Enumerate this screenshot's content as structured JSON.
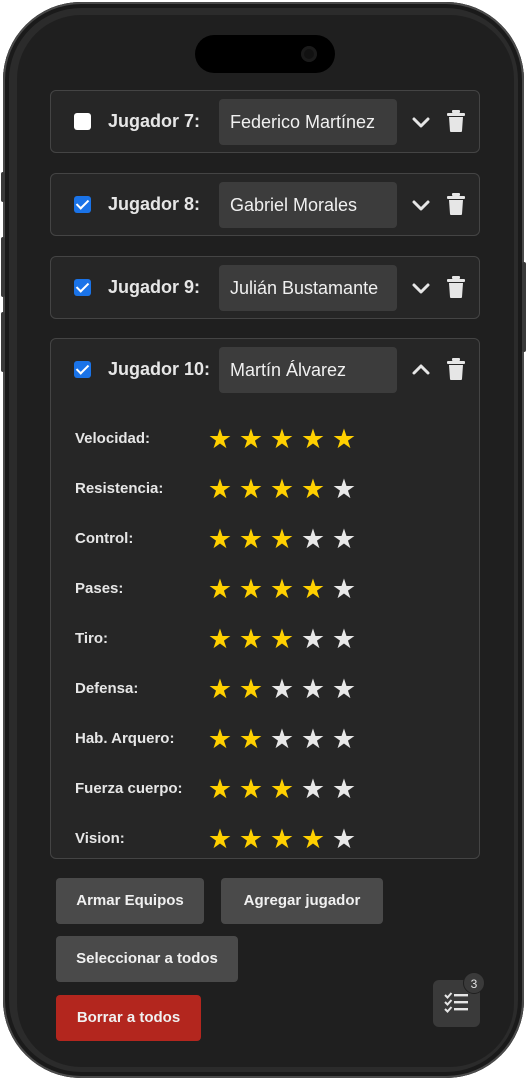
{
  "players": [
    {
      "label": "Jugador 7:",
      "name": "Federico Martínez",
      "checked": false,
      "expanded": false
    },
    {
      "label": "Jugador 8:",
      "name": "Gabriel Morales",
      "checked": true,
      "expanded": false
    },
    {
      "label": "Jugador 9:",
      "name": "Julián Bustamante",
      "checked": true,
      "expanded": false
    },
    {
      "label": "Jugador 10:",
      "name": "Martín Álvarez",
      "checked": true,
      "expanded": true
    }
  ],
  "attributes": [
    {
      "label": "Velocidad:",
      "rating": 5
    },
    {
      "label": "Resistencia:",
      "rating": 4
    },
    {
      "label": "Control:",
      "rating": 3
    },
    {
      "label": "Pases:",
      "rating": 4
    },
    {
      "label": "Tiro:",
      "rating": 3
    },
    {
      "label": "Defensa:",
      "rating": 2
    },
    {
      "label": "Hab. Arquero:",
      "rating": 2
    },
    {
      "label": "Fuerza cuerpo:",
      "rating": 3
    },
    {
      "label": "Vision:",
      "rating": 4
    }
  ],
  "max_rating": 5,
  "actions": {
    "armar": "Armar Equipos",
    "agregar": "Agregar jugador",
    "seleccionar": "Seleccionar a todos",
    "borrar": "Borrar a todos"
  },
  "fab": {
    "badge_count": "3",
    "icon": "checklist-icon"
  },
  "colors": {
    "background": "#1f1f1f",
    "card": "#262626",
    "checkbox_checked": "#1a73e8",
    "star_on": "#ffd000",
    "star_off": "#e8e8e8",
    "danger": "#b3261e"
  }
}
